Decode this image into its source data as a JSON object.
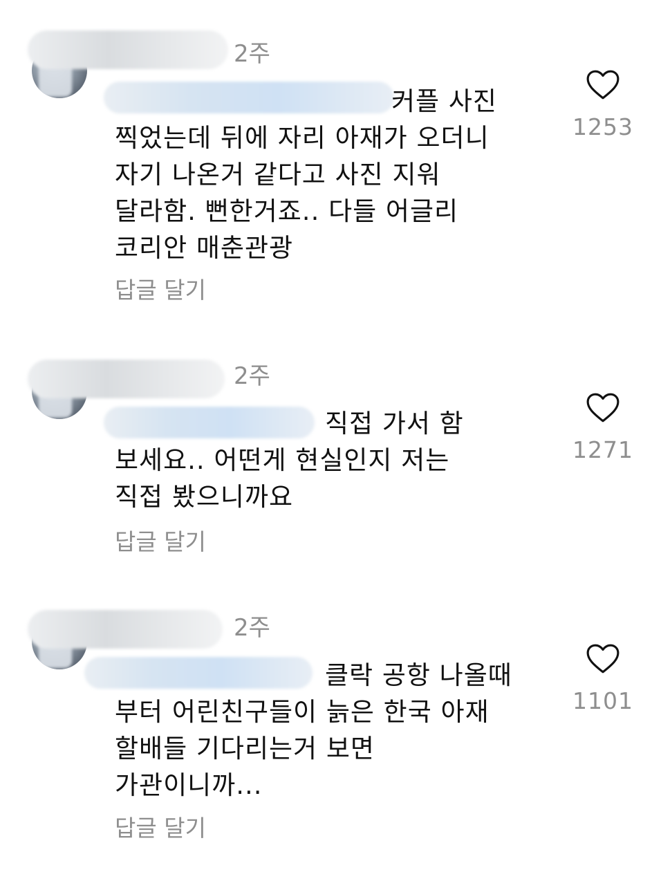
{
  "comments": [
    {
      "time": "2주",
      "lead_text": "커플 사진",
      "body_text": "찍었는데 뒤에 자리 아재가 오더니\n자기 나온거 같다고 사진 지워\n달라함. 뻔한거죠.. 다들 어글리\n코리안 매춘관광",
      "reply_label": "답글 달기",
      "likes": "1253"
    },
    {
      "time": "2주",
      "lead_text": "직접 가서 함",
      "body_text": "보세요.. 어떤게 현실인지 저는\n직접 봤으니까요",
      "reply_label": "답글 달기",
      "likes": "1271"
    },
    {
      "time": "2주",
      "lead_text": "클락 공항 나올때",
      "body_text": "부터 어린친구들이 늙은 한국 아재\n할배들 기다리는거 보면\n가관이니까...",
      "reply_label": "답글 달기",
      "likes": "1101"
    }
  ],
  "icons": {
    "like": "heart-outline-icon"
  },
  "colors": {
    "text": "#111111",
    "muted": "#8e8e8e",
    "mention": "#1e6fd9"
  }
}
